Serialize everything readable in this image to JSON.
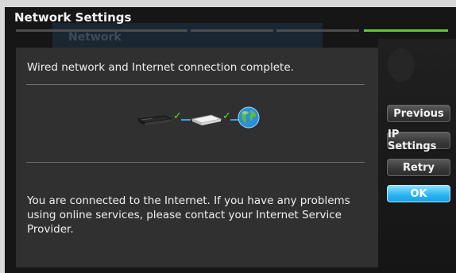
{
  "window": {
    "title": "Network Settings",
    "background_label": "Network"
  },
  "progress": {
    "steps": 4,
    "completed_step": 4
  },
  "panel": {
    "headline": "Wired network and Internet connection complete.",
    "message": "You are connected to the Internet. If you have any problems using online services, please contact your Internet Service Provider.",
    "connection_chain": [
      "device-icon",
      "check-icon",
      "router-icon",
      "check-icon",
      "globe-icon"
    ]
  },
  "buttons": {
    "previous": "Previous",
    "ip_settings": "IP Settings",
    "retry": "Retry",
    "ok": "OK",
    "focused": "ok"
  },
  "colors": {
    "accent": "#29b3f2",
    "progress_done": "#63c63b",
    "check": "#6fd33a"
  }
}
